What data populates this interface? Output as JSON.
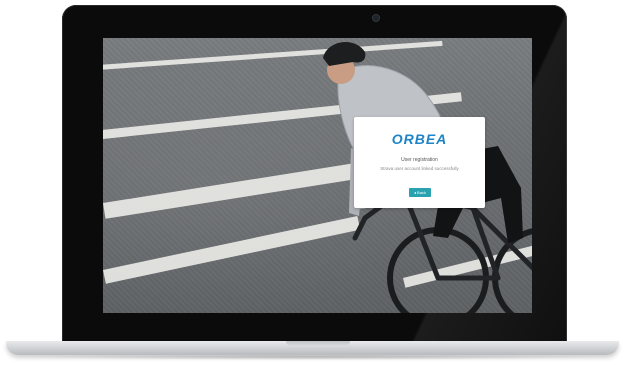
{
  "brand": {
    "logo_text": "ORBEA",
    "logo_color": "#1e84c6"
  },
  "card": {
    "title": "User registration",
    "message": "Strava user account linked successfully",
    "back_button": {
      "icon": "arrow-left-icon",
      "label": "Back",
      "color": "#2aa3b0"
    }
  }
}
